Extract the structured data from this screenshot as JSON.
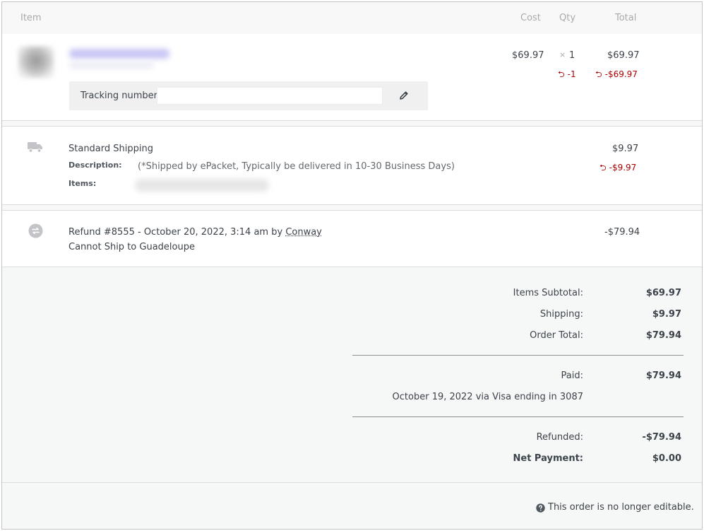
{
  "header": {
    "item_label": "Item",
    "cost_label": "Cost",
    "qty_label": "Qty",
    "total_label": "Total"
  },
  "line_item": {
    "cost": "$69.97",
    "qty_prefix": "×",
    "qty": "1",
    "total": "$69.97",
    "refund_qty": "-1",
    "refund_total": "-$69.97",
    "tracking_label": "Tracking number",
    "tracking_value": ""
  },
  "shipping": {
    "name": "Standard Shipping",
    "description_label": "Description:",
    "description_value": "(*Shipped by ePacket, Typically be delivered in 10-30 Business Days)",
    "items_label": "Items:",
    "total": "$9.97",
    "refund_total": "-$9.97"
  },
  "refund": {
    "prefix": "Refund #8555 - October 20, 2022, 3:14 am by",
    "author": "Conway",
    "reason": "Cannot Ship to Guadeloupe",
    "amount": "-$79.94"
  },
  "totals": {
    "items_subtotal_label": "Items Subtotal:",
    "items_subtotal": "$69.97",
    "shipping_label": "Shipping:",
    "shipping": "$9.97",
    "order_total_label": "Order Total:",
    "order_total": "$79.94",
    "paid_label": "Paid:",
    "paid": "$79.94",
    "paid_note": "October 19, 2022 via Visa ending in 3087",
    "refunded_label": "Refunded:",
    "refunded": "-$79.94",
    "net_payment_label": "Net Payment:",
    "net_payment": "$0.00"
  },
  "footer": {
    "notice": "This order is no longer editable."
  },
  "colors": {
    "refund_red": "#aa0000",
    "icon_gray": "#c3c4c7"
  }
}
